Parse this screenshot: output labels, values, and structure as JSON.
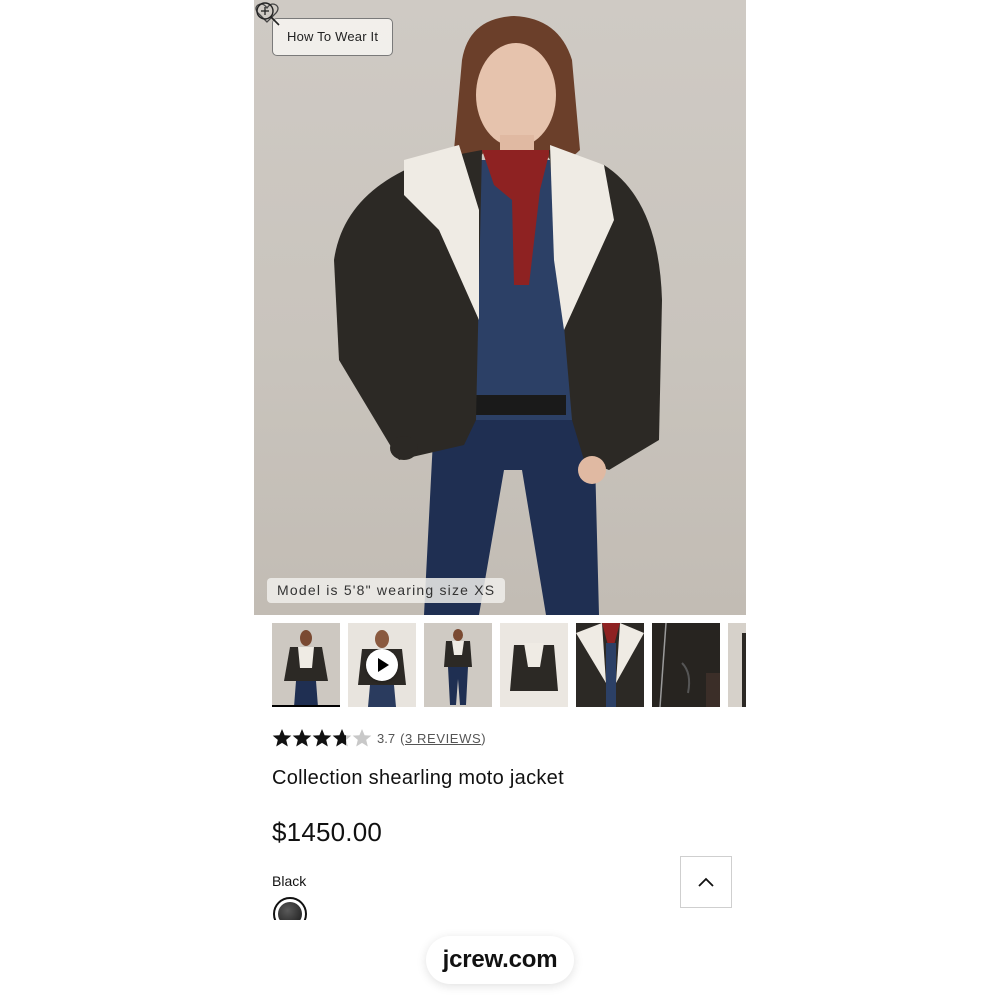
{
  "hero": {
    "how_to_label": "How To Wear It",
    "model_info": "Model is 5'8\" wearing size XS",
    "icons": [
      "heart-icon",
      "zoom-in-icon"
    ]
  },
  "thumbnails": [
    {
      "kind": "image",
      "active": true
    },
    {
      "kind": "video",
      "active": false
    },
    {
      "kind": "image",
      "active": false
    },
    {
      "kind": "image",
      "active": false
    },
    {
      "kind": "image",
      "active": false
    },
    {
      "kind": "image",
      "active": false
    },
    {
      "kind": "image",
      "active": false
    }
  ],
  "rating": {
    "stars": 3.7,
    "value_text": "3.7",
    "reviews_open": "(",
    "reviews_text": "3 REVIEWS",
    "reviews_close": ")"
  },
  "product": {
    "title": "Collection shearling moto jacket",
    "price": "$1450.00",
    "color_label": "Black"
  },
  "colors": {
    "swatch_black": "#2a2a2a",
    "text": "#111111",
    "star_filled": "#111111",
    "star_empty": "#c8c8c8"
  },
  "footer": {
    "url": "jcrew.com",
    "back_to_top_icon": "chevron-up-icon"
  }
}
